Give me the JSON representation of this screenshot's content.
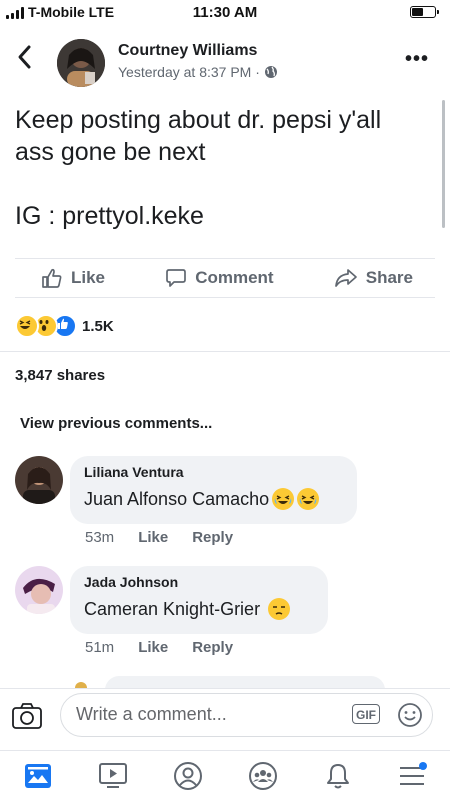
{
  "status_bar": {
    "carrier": "T-Mobile  LTE",
    "time": "11:30 AM",
    "battery_level": 0.45
  },
  "post": {
    "author": "Courtney Williams",
    "timestamp": "Yesterday at 8:37 PM ·",
    "privacy_icon": "globe-icon",
    "text": "Keep posting about dr. pepsi y'all\nass gone be next\n\nIG : prettyol.keke",
    "actions": {
      "like": "Like",
      "comment": "Comment",
      "share": "Share"
    },
    "reaction_icons": [
      "haha-emoji",
      "wow-emoji",
      "like-icon"
    ],
    "reaction_count": "1.5K",
    "shares": "3,847 shares"
  },
  "comments_section": {
    "view_previous": "View previous comments...",
    "comments": [
      {
        "name": "Liliana Ventura",
        "text": "Juan Alfonso Camacho",
        "emojis": [
          "crying-emoji",
          "crying-emoji"
        ],
        "time": "53m",
        "like": "Like",
        "reply": "Reply"
      },
      {
        "name": "Jada Johnson",
        "text": "Cameran Knight-Grier",
        "emojis": [
          "unamused-emoji"
        ],
        "time": "51m",
        "like": "Like",
        "reply": "Reply"
      }
    ]
  },
  "composer": {
    "placeholder": "Write a comment...",
    "gif_label": "GIF"
  },
  "tab_bar": {
    "items": [
      "news-feed-icon",
      "watch-icon",
      "profile-icon",
      "groups-icon",
      "notifications-icon",
      "menu-icon"
    ]
  },
  "colors": {
    "brand_blue": "#1877f2",
    "secondary_text": "#606770",
    "bubble_bg": "#f0f2f5"
  }
}
